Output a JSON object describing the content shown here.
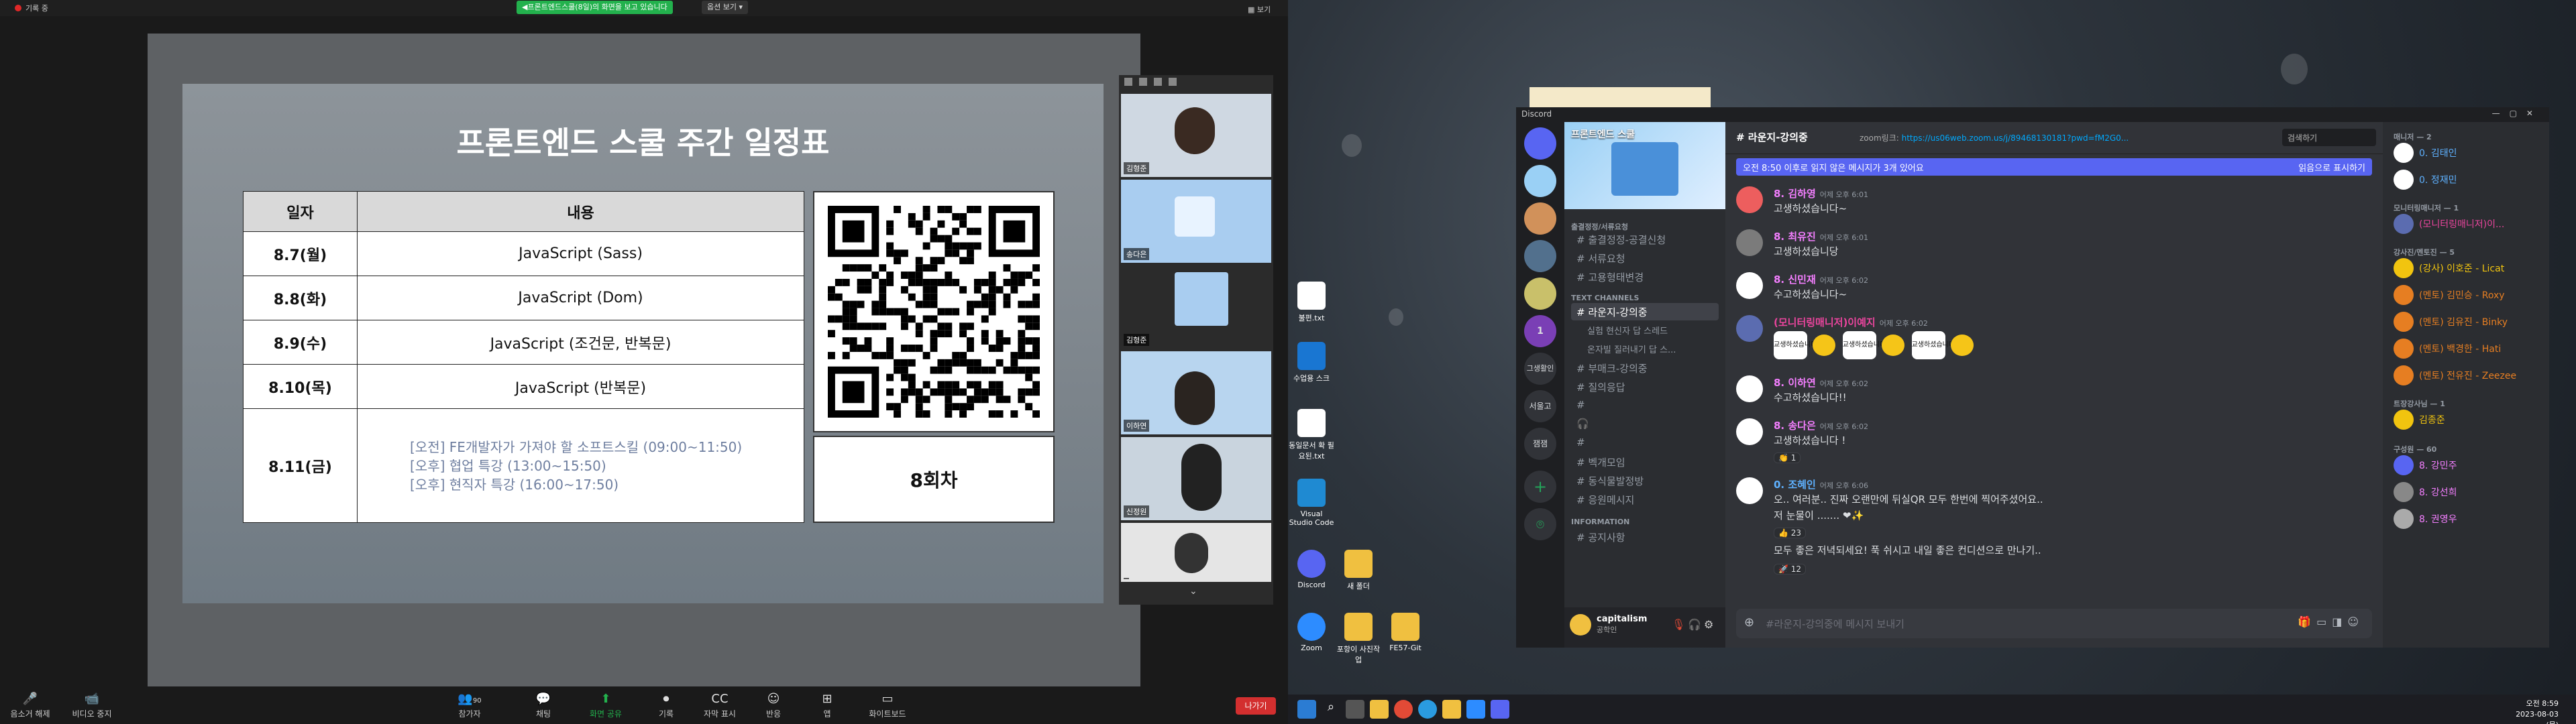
{
  "zoom": {
    "recording_label": "기록 중",
    "share_notice": "◀프론트엔드스쿨(8일)의 화면을 보고 있습니다",
    "view_options": "옵션 보기 ▾",
    "view_button": "▦ 보기",
    "slide": {
      "title": "프론트엔드 스쿨 주간 일정표",
      "table": {
        "headers": [
          "일자",
          "내용"
        ],
        "rows": [
          {
            "date": "8.7(월)",
            "content": "JavaScript (Sass)"
          },
          {
            "date": "8.8(화)",
            "content": "JavaScript (Dom)"
          },
          {
            "date": "8.9(수)",
            "content": "JavaScript (조건문, 반복문)"
          },
          {
            "date": "8.10(목)",
            "content": "JavaScript (반복문)"
          },
          {
            "date": "8.11(금)",
            "lines": [
              "[오전] FE개발자가 가져야 할 소프트스킬 (09:00~11:50)",
              "[오후] 협업 특강 (13:00~15:50)",
              "[오후] 현직자 특강 (16:00~17:50)"
            ]
          }
        ]
      },
      "round": "8회차"
    },
    "gallery": [
      {
        "name": "김형준"
      },
      {
        "name": "송다은"
      },
      {
        "name": "김형준"
      },
      {
        "name": "이하연"
      },
      {
        "name": "신정원"
      },
      {
        "name": ""
      }
    ],
    "toolbar": [
      {
        "id": "mute",
        "label": "음소거 해제",
        "icon": "🎤"
      },
      {
        "id": "video",
        "label": "비디오 중지",
        "icon": "📹"
      },
      {
        "id": "participants",
        "label": "참가자",
        "icon": "👥"
      },
      {
        "id": "chat",
        "label": "채팅",
        "icon": "💬"
      },
      {
        "id": "share",
        "label": "화면 공유",
        "icon": "⬆"
      },
      {
        "id": "record",
        "label": "기록",
        "icon": "⏺"
      },
      {
        "id": "cc",
        "label": "자막 표시",
        "icon": "CC"
      },
      {
        "id": "reactions",
        "label": "반응",
        "icon": "☺"
      },
      {
        "id": "apps",
        "label": "앱",
        "icon": "⊞"
      },
      {
        "id": "whiteboard",
        "label": "화이트보드",
        "icon": "▭"
      }
    ],
    "participant_count": "90",
    "leave": "나가기"
  },
  "desktop": {
    "icons": [
      {
        "label": "불편.txt",
        "color": "#ffffff"
      },
      {
        "label": "수업용 스크",
        "color": "#1976d2"
      },
      {
        "label": "동일문서 확 필요된.txt",
        "color": "#ffffff"
      },
      {
        "label": "Visual Studio Code",
        "color": "#1f8ad2"
      },
      {
        "label": "Discord",
        "color": "#5865f2"
      },
      {
        "label": "새 폴더",
        "color": "#f0c040"
      },
      {
        "label": "Zoom",
        "color": "#2d8cff"
      },
      {
        "label": "포항이 사진작업",
        "color": "#f0c040"
      },
      {
        "label": "FE57-Git",
        "color": "#f0c040"
      }
    ],
    "clock": {
      "time": "오전 8:59",
      "date": "2023-08-03 (목)"
    }
  },
  "discord": {
    "app_title": "Discord",
    "server_banner": "프론트엔드 스쿨",
    "categories": [
      "출결정정/서류요청",
      "TEXT CHANNELS",
      "INFORMATION"
    ],
    "channels_a": [
      "출결정정-공결신청",
      "서류요청",
      "고용형태변경"
    ],
    "channels_b": [
      "라운지-강의중",
      "실험 현신자 답 스레드",
      "온자빌 질러내기 답 스...",
      "부매크-강의중",
      "질의응답",
      "",
      "",
      "",
      "벡개모임",
      "동식물발정방",
      "응원메시지"
    ],
    "channels_c": [
      "공지사항"
    ],
    "servers": [
      "",
      "",
      "",
      "",
      "",
      "1",
      "그생활인",
      "서울고",
      "잼잼"
    ],
    "user": {
      "name": "capitalism",
      "status": "공학인"
    },
    "header": {
      "channel": "라운지-강의중",
      "zoom_label": "zoom링크: ",
      "zoom_link": "https://us06web.zoom.us/j/89468130181?pwd=fM2G0...",
      "search": "검색하기"
    },
    "new_bar": {
      "text": "오전 8:50 이후로 읽지 않은 메시지가 3개 있어요",
      "action": "읽음으로 표시하기"
    },
    "messages": [
      {
        "name": "8. 김하영",
        "time": "어제 오후 6:01",
        "color": "#f47fff",
        "avatar": "#ed5e5e",
        "text": "고생하셨습니다~"
      },
      {
        "name": "8. 최유진",
        "time": "어제 오후 6:01",
        "color": "#f47fff",
        "avatar": "#7b7b7b",
        "text": "고생하셨습니당"
      },
      {
        "name": "8. 신민재",
        "time": "어제 오후 6:02",
        "color": "#f47fff",
        "avatar": "#ffffff",
        "text": "수고하셨습니다~"
      },
      {
        "name": "(모니터링매니저)이예지",
        "time": "어제 오후 6:02",
        "color": "#eb459e",
        "avatar": "#5b6cb0",
        "text": ""
      },
      {
        "name": "8. 이하연",
        "time": "어제 오후 6:02",
        "color": "#f47fff",
        "avatar": "#ffffff",
        "text": "수고하셨습니다!!"
      },
      {
        "name": "8. 송다은",
        "time": "어제 오후 6:02",
        "color": "#f47fff",
        "avatar": "#ffffff",
        "text": "고생하셨습니다 !"
      },
      {
        "name": "0. 조혜인",
        "time": "어제 오후 6:06",
        "color": "#5eb1ff",
        "avatar": "#ffffff",
        "text": "오.. 여러분.. 진짜 오랜만에 뒤실QR 모두 한번에 찍어주셨어요..",
        "text2": "저 눈물이 ....... ❤✨",
        "text3": "모두 좋은 저녁되세요! 푹 쉬시고 내일 좋은 컨디션으로 만나기.."
      }
    ],
    "stickers": [
      "교생하셨습니다",
      "교생하셨습니다",
      "교생하셨습니다"
    ],
    "reactions": {
      "songdaeun": "👏 1",
      "jo1": "👍 23",
      "jo2": "🚀 12"
    },
    "input_placeholder": "#라운지-강의중에 메시지 보내기",
    "members": {
      "groups": [
        {
          "title": "매니저 — 2",
          "items": [
            {
              "name": "0. 김태인",
              "color": "#5eb1ff"
            },
            {
              "name": "0. 정재민",
              "color": "#5eb1ff"
            }
          ]
        },
        {
          "title": "모니터링매니저 — 1",
          "items": [
            {
              "name": "(모니터링매니저)이...",
              "color": "#eb459e"
            }
          ]
        },
        {
          "title": "강사진/멘토진 — 5",
          "items": [
            {
              "name": "(강사) 이호준 - Licat",
              "color": "#f1c40f"
            },
            {
              "name": "(멘토) 김민승 - Roxy",
              "color": "#e67e22"
            },
            {
              "name": "(멘토) 김유진 - Binky",
              "color": "#e67e22"
            },
            {
              "name": "(멘토) 백경한 - Hati",
              "color": "#e67e22"
            },
            {
              "name": "(멘토) 전유진 - Zeezee",
              "color": "#e67e22"
            }
          ]
        },
        {
          "title": "트장강사님 — 1",
          "items": [
            {
              "name": "김종준",
              "color": "#f1c40f"
            }
          ]
        },
        {
          "title": "구성원 — 60",
          "items": [
            {
              "name": "8. 강민주",
              "color": "#f47fff"
            },
            {
              "name": "8. 강선희",
              "color": "#f47fff"
            },
            {
              "name": "8. 권영우",
              "color": "#f47fff"
            }
          ]
        }
      ]
    }
  }
}
